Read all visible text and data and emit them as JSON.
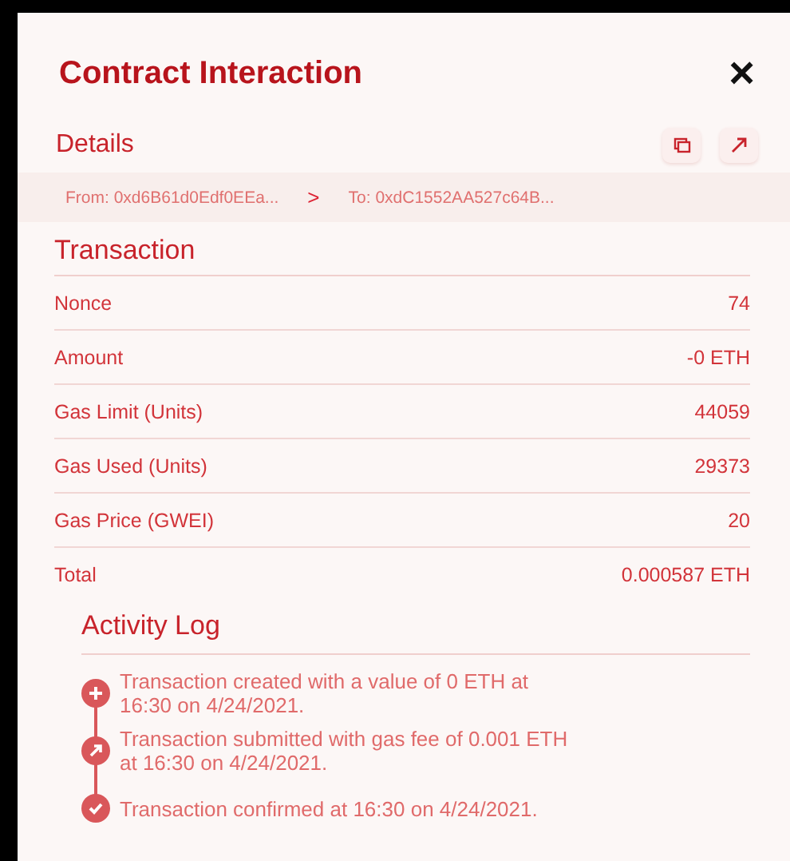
{
  "title": "Contract Interaction",
  "close": "×",
  "details": {
    "heading": "Details",
    "from": "From: 0xd6B61d0Edf0EEa...",
    "separator": ">",
    "to": "To: 0xdC1552AA527c64B..."
  },
  "transaction": {
    "heading": "Transaction",
    "rows": [
      {
        "label": "Nonce",
        "value": "74"
      },
      {
        "label": "Amount",
        "value": "-0 ETH"
      },
      {
        "label": "Gas Limit (Units)",
        "value": "44059"
      },
      {
        "label": "Gas Used (Units)",
        "value": "29373"
      },
      {
        "label": "Gas Price (GWEI)",
        "value": "20"
      },
      {
        "label": "Total",
        "value": "0.000587 ETH"
      }
    ]
  },
  "activity_log": {
    "heading": "Activity Log",
    "entries": [
      {
        "kind": "created",
        "text": "Transaction created with a value of 0 ETH at 16:30 on 4/24/2021."
      },
      {
        "kind": "submitted",
        "text": "Transaction submitted with gas fee of 0.001 ETH at 16:30 on 4/24/2021."
      },
      {
        "kind": "confirmed",
        "text": "Transaction confirmed at 16:30 on 4/24/2021."
      }
    ]
  }
}
